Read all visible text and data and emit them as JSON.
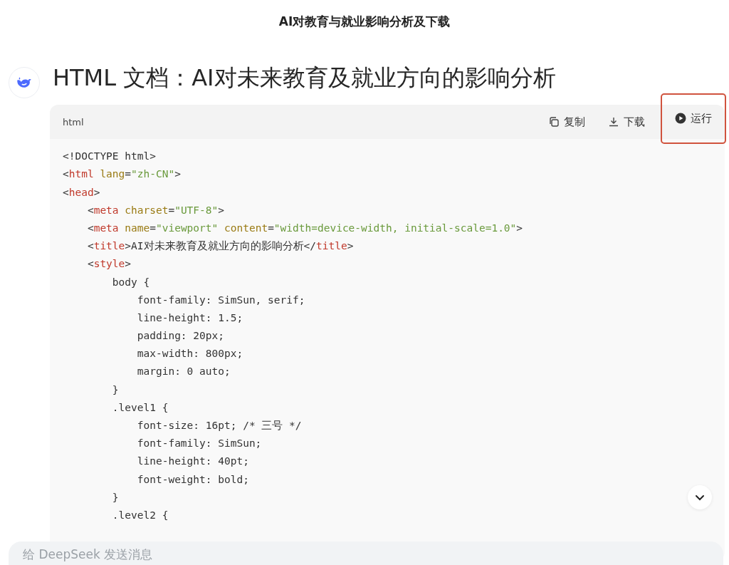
{
  "window": {
    "title": "AI对教育与就业影响分析及下载"
  },
  "message": {
    "heading": "HTML 文档：AI对未来教育及就业方向的影响分析"
  },
  "code_block": {
    "language": "html",
    "actions": [
      {
        "kind": "copy",
        "label": "复制",
        "highlighted": false
      },
      {
        "kind": "download",
        "label": "下载",
        "highlighted": false
      },
      {
        "kind": "run",
        "label": "运行",
        "highlighted": true
      }
    ],
    "lines": [
      [
        {
          "kind": "plain",
          "text": "<!DOCTYPE html>"
        }
      ],
      [
        {
          "kind": "plain",
          "text": "<"
        },
        {
          "kind": "tag",
          "text": "html"
        },
        {
          "kind": "attr",
          "text": " lang"
        },
        {
          "kind": "plain",
          "text": "="
        },
        {
          "kind": "string",
          "text": "\"zh-CN\""
        },
        {
          "kind": "plain",
          "text": ">"
        }
      ],
      [
        {
          "kind": "plain",
          "text": "<"
        },
        {
          "kind": "tag",
          "text": "head"
        },
        {
          "kind": "plain",
          "text": ">"
        }
      ],
      [
        {
          "kind": "plain",
          "text": "    <"
        },
        {
          "kind": "tag",
          "text": "meta"
        },
        {
          "kind": "attr",
          "text": " charset"
        },
        {
          "kind": "plain",
          "text": "="
        },
        {
          "kind": "string",
          "text": "\"UTF-8\""
        },
        {
          "kind": "plain",
          "text": ">"
        }
      ],
      [
        {
          "kind": "plain",
          "text": "    <"
        },
        {
          "kind": "tag",
          "text": "meta"
        },
        {
          "kind": "attr",
          "text": " name"
        },
        {
          "kind": "plain",
          "text": "="
        },
        {
          "kind": "string",
          "text": "\"viewport\""
        },
        {
          "kind": "attr",
          "text": " content"
        },
        {
          "kind": "plain",
          "text": "="
        },
        {
          "kind": "string",
          "text": "\"width=device-width, initial-scale=1.0\""
        },
        {
          "kind": "plain",
          "text": ">"
        }
      ],
      [
        {
          "kind": "plain",
          "text": "    <"
        },
        {
          "kind": "tag",
          "text": "title"
        },
        {
          "kind": "plain",
          "text": ">AI对未来教育及就业方向的影响分析</"
        },
        {
          "kind": "tag",
          "text": "title"
        },
        {
          "kind": "plain",
          "text": ">"
        }
      ],
      [
        {
          "kind": "plain",
          "text": "    <"
        },
        {
          "kind": "tag",
          "text": "style"
        },
        {
          "kind": "plain",
          "text": ">"
        }
      ],
      [
        {
          "kind": "plain",
          "text": "        body {"
        }
      ],
      [
        {
          "kind": "plain",
          "text": "            font-family: SimSun, serif;"
        }
      ],
      [
        {
          "kind": "plain",
          "text": "            line-height: 1.5;"
        }
      ],
      [
        {
          "kind": "plain",
          "text": "            padding: 20px;"
        }
      ],
      [
        {
          "kind": "plain",
          "text": "            max-width: 800px;"
        }
      ],
      [
        {
          "kind": "plain",
          "text": "            margin: 0 auto;"
        }
      ],
      [
        {
          "kind": "plain",
          "text": "        }"
        }
      ],
      [
        {
          "kind": "plain",
          "text": "        .level1 {"
        }
      ],
      [
        {
          "kind": "plain",
          "text": "            font-size: 16pt; /* 三号 */"
        }
      ],
      [
        {
          "kind": "plain",
          "text": "            font-family: SimSun;"
        }
      ],
      [
        {
          "kind": "plain",
          "text": "            line-height: 40pt;"
        }
      ],
      [
        {
          "kind": "plain",
          "text": "            font-weight: bold;"
        }
      ],
      [
        {
          "kind": "plain",
          "text": "        }"
        }
      ],
      [
        {
          "kind": "plain",
          "text": "        .level2 {"
        }
      ]
    ]
  },
  "composer": {
    "placeholder": "给 DeepSeek 发送消息"
  }
}
